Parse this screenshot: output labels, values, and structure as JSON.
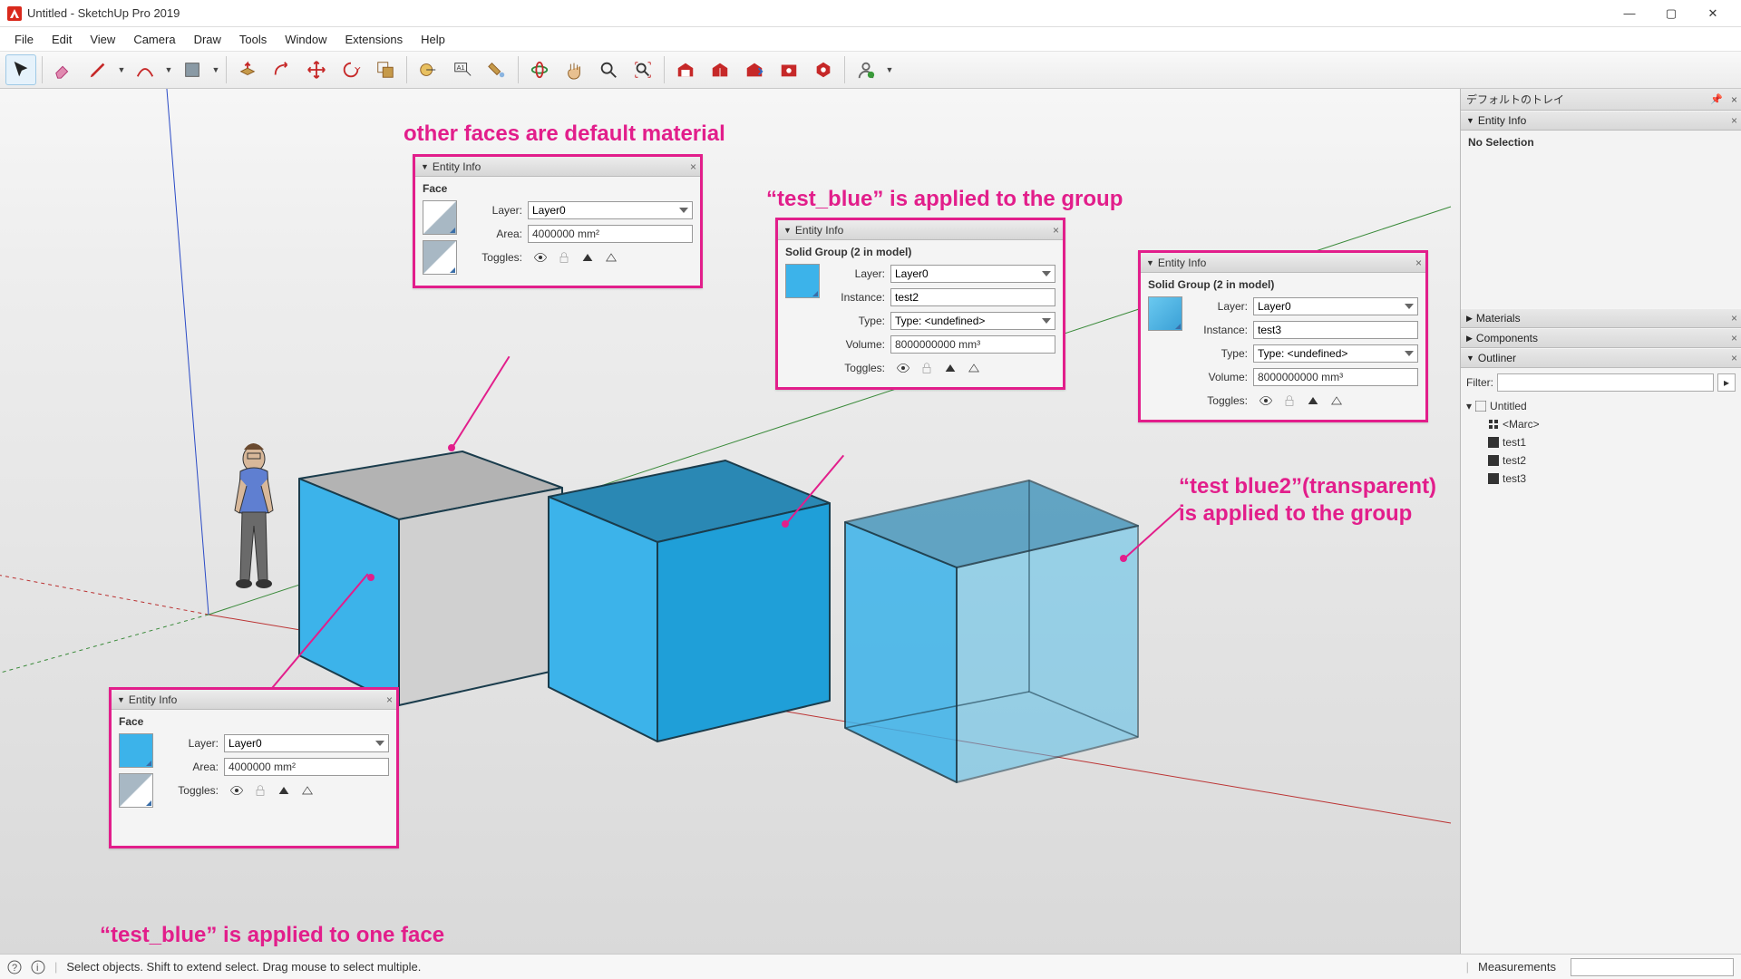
{
  "window": {
    "title": "Untitled - SketchUp Pro 2019"
  },
  "menu": [
    "File",
    "Edit",
    "View",
    "Camera",
    "Draw",
    "Tools",
    "Window",
    "Extensions",
    "Help"
  ],
  "status": {
    "hint": "Select objects. Shift to extend select. Drag mouse to select multiple.",
    "measure_label": "Measurements"
  },
  "tray": {
    "title": "デフォルトのトレイ",
    "entity_info": {
      "title": "Entity Info",
      "body": "No Selection"
    },
    "materials": {
      "title": "Materials"
    },
    "components": {
      "title": "Components"
    },
    "outliner": {
      "title": "Outliner",
      "filter_label": "Filter:",
      "root": "Untitled",
      "marc": "<Marc>",
      "items": [
        "test1",
        "test2",
        "test3"
      ]
    }
  },
  "panels": {
    "face_top": {
      "title": "Entity Info",
      "subtitle": "Face",
      "layer": "Layer0",
      "area": "4000000 mm²",
      "labels": {
        "layer": "Layer:",
        "area": "Area:",
        "toggles": "Toggles:"
      }
    },
    "face_bottom": {
      "title": "Entity Info",
      "subtitle": "Face",
      "layer": "Layer0",
      "area": "4000000 mm²",
      "labels": {
        "layer": "Layer:",
        "area": "Area:",
        "toggles": "Toggles:"
      }
    },
    "group2": {
      "title": "Entity Info",
      "subtitle": "Solid Group (2 in model)",
      "layer": "Layer0",
      "instance": "test2",
      "type": "Type: <undefined>",
      "volume": "8000000000 mm³",
      "labels": {
        "layer": "Layer:",
        "instance": "Instance:",
        "type": "Type:",
        "volume": "Volume:",
        "toggles": "Toggles:"
      }
    },
    "group3": {
      "title": "Entity Info",
      "subtitle": "Solid Group (2 in model)",
      "layer": "Layer0",
      "instance": "test3",
      "type": "Type: <undefined>",
      "volume": "8000000000 mm³",
      "labels": {
        "layer": "Layer:",
        "instance": "Instance:",
        "type": "Type:",
        "volume": "Volume:",
        "toggles": "Toggles:"
      }
    }
  },
  "annot": {
    "a1": "other faces are default material",
    "a2": "“test_blue” is applied to the group",
    "a3a": "“test blue2”(transparent)",
    "a3b": "is applied to the group",
    "a4": "“test_blue” is applied to one face"
  },
  "colors": {
    "pink": "#e21e8b",
    "blue": "#3cb3ea",
    "blue_top": "#2a88b4",
    "blue_side": "#1f9fd8",
    "gray_top": "#b3b3b3",
    "gray_side": "#d0d0d0"
  }
}
